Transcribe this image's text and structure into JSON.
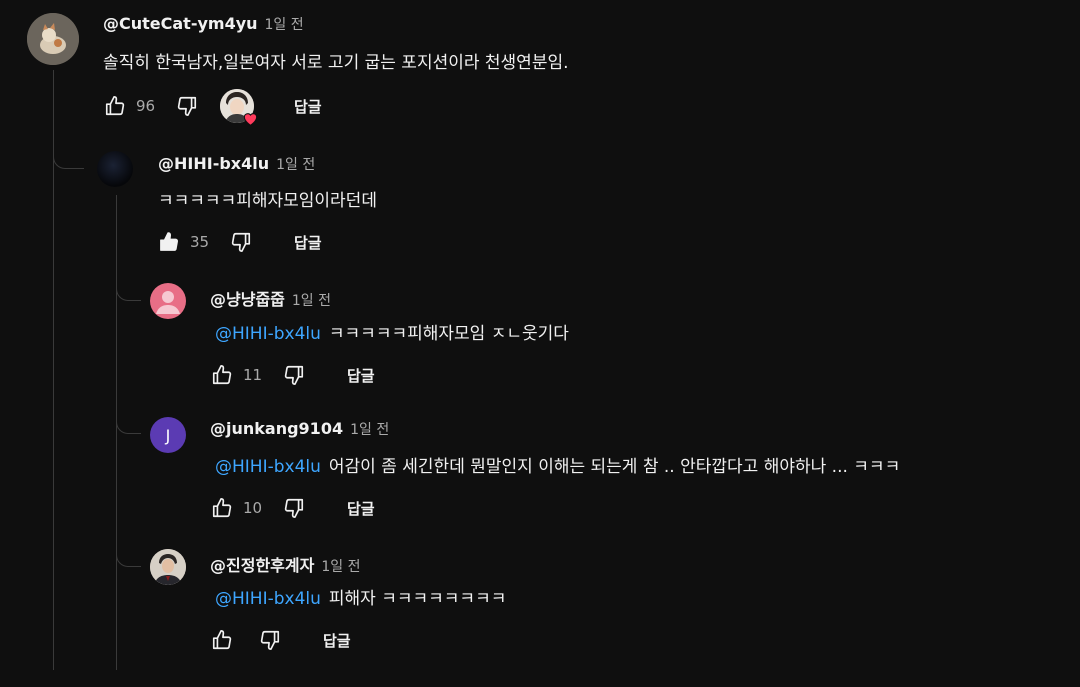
{
  "comments": [
    {
      "author": "@CuteCat-ym4yu",
      "time": "1일 전",
      "text": "솔직히 한국남자,일본여자 서로 고기 굽는 포지션이라 천생연분임.",
      "likes": "96",
      "reply_label": "답글",
      "creator_heart": true
    }
  ],
  "replies": [
    {
      "author": "@HIHI-bx4lu",
      "time": "1일 전",
      "mention": "",
      "text": "ㅋㅋㅋㅋㅋ피해자모임이라던데",
      "likes": "35",
      "liked": true,
      "reply_label": "답글"
    },
    {
      "author": "@냥냥줍줍",
      "time": "1일 전",
      "mention": "@HIHI-bx4lu",
      "text": "ㅋㅋㅋㅋㅋ피해자모임 ㅈㄴ웃기다",
      "likes": "11",
      "liked": false,
      "reply_label": "답글"
    },
    {
      "author": "@junkang9104",
      "time": "1일 전",
      "mention": "@HIHI-bx4lu",
      "text": "어감이 좀 세긴한데 뭔말인지 이해는 되는게 참 .. 안타깝다고 해야하나 ... ㅋㅋㅋ",
      "likes": "10",
      "liked": false,
      "reply_label": "답글",
      "avatar_letter": "J"
    },
    {
      "author": "@진정한후계자",
      "time": "1일 전",
      "mention": "@HIHI-bx4lu",
      "text": "피해자 ㅋㅋㅋㅋㅋㅋㅋㅋ",
      "likes": "",
      "liked": false,
      "reply_label": "답글"
    }
  ],
  "colors": {
    "background": "#0f0f0f",
    "mention": "#3ea6ff",
    "heart": "#ff3b5c",
    "junkang_avatar": "#5b3bb3",
    "nyang_avatar": "#e86e86"
  }
}
